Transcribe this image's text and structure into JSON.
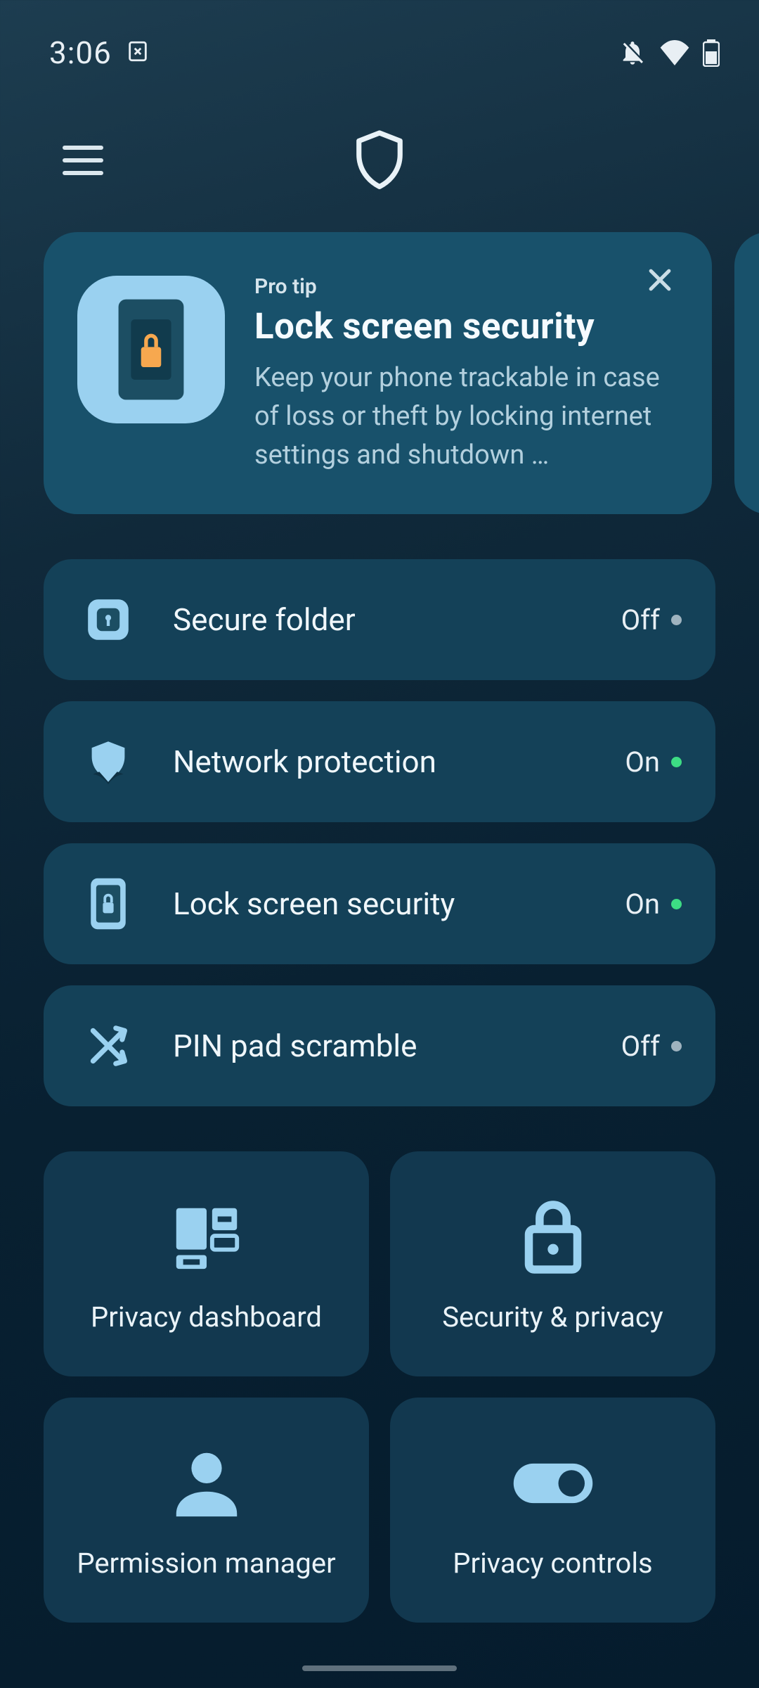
{
  "status_bar": {
    "time": "3:06"
  },
  "tip": {
    "eyebrow": "Pro tip",
    "title": "Lock screen security",
    "body": "Keep your phone trackable in case of loss or theft by locking internet settings and shutdown …"
  },
  "settings": [
    {
      "label": "Secure folder",
      "status": "Off",
      "on": false
    },
    {
      "label": "Network protection",
      "status": "On",
      "on": true
    },
    {
      "label": "Lock screen security",
      "status": "On",
      "on": true
    },
    {
      "label": "PIN pad scramble",
      "status": "Off",
      "on": false
    }
  ],
  "grid": [
    {
      "label": "Privacy dashboard"
    },
    {
      "label": "Security & privacy"
    },
    {
      "label": "Permission manager"
    },
    {
      "label": "Privacy controls"
    }
  ]
}
